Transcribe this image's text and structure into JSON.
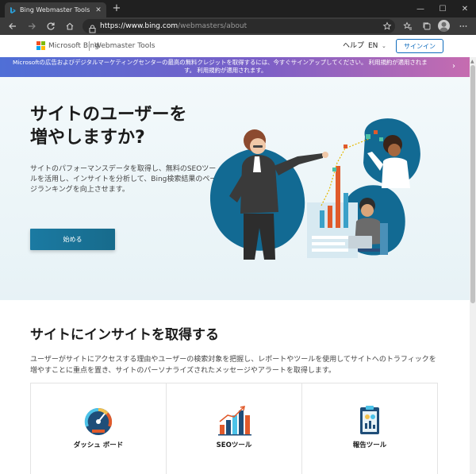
{
  "browser": {
    "tab_title": "Bing Webmaster Tools",
    "tab_close_glyph": "✕",
    "new_tab_glyph": "+",
    "url_host": "https://www.bing.com",
    "url_path": "/webmasters/about",
    "window_minimize": "—",
    "window_maximize": "☐",
    "window_close": "✕"
  },
  "site_header": {
    "brand": "Microsoft Bing",
    "product": "Webmaster Tools",
    "help": "ヘルプ",
    "language": "EN",
    "language_chevron": "⌄",
    "signin": "サインイン"
  },
  "banner": {
    "line1": "Microsoftの広告およびデジタルマーケティングセンターの最高の無料クレジットを取得するには、今すぐサインアップしてください。 利用規約が適用されま",
    "line2": "す。 利用規約が適用されます。",
    "chevron": "›"
  },
  "hero": {
    "title_line1": "サイトのユーザーを",
    "title_line2": "増やしますか?",
    "description": "サイトのパフォーマンスデータを取得し、無料のSEOツールを活用し、インサイトを分析して、Bing検索結果のページランキングを向上させます。",
    "cta": "始める"
  },
  "insights": {
    "title": "サイトにインサイトを取得する",
    "description": "ユーザーがサイトにアクセスする理由やユーザーの検索対象を把握し、レポートやツールを使用してサイトへのトラフィックを増やすことに重点を置き、サイトのパーソナライズされたメッセージやアラートを取得します。",
    "cards": [
      {
        "label": "ダッシュ ボード",
        "icon": "dashboard-gauge-icon"
      },
      {
        "label": "SEOツール",
        "icon": "seo-tools-chart-icon"
      },
      {
        "label": "報告ツール",
        "icon": "report-clipboard-icon"
      }
    ]
  },
  "colors": {
    "accent": "#0f6cbd",
    "cta": "#1b7aa2",
    "banner_start": "#4f6fd6",
    "banner_end": "#c66cb0",
    "hero_bg": "#eef6f9"
  }
}
